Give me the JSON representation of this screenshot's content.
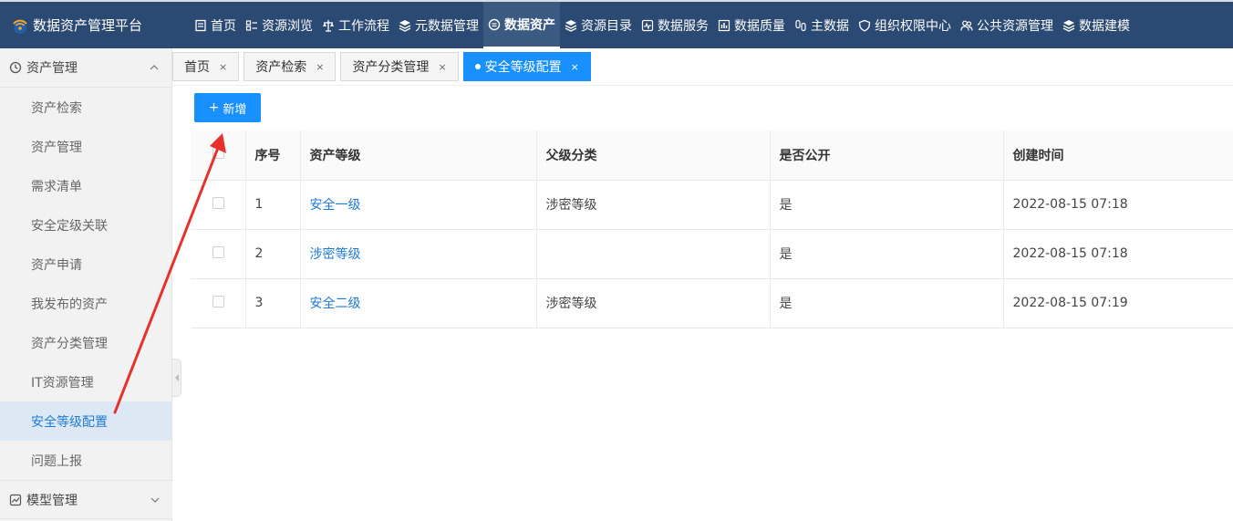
{
  "app": {
    "title": "数据资产管理平台"
  },
  "nav": {
    "items": [
      {
        "label": "首页",
        "icon": "doc-icon"
      },
      {
        "label": "资源浏览",
        "icon": "list-icon"
      },
      {
        "label": "工作流程",
        "icon": "balance-icon"
      },
      {
        "label": "元数据管理",
        "icon": "layers-icon"
      },
      {
        "label": "数据资产",
        "icon": "database-icon",
        "active": true
      },
      {
        "label": "资源目录",
        "icon": "layers-icon"
      },
      {
        "label": "数据服务",
        "icon": "pulse-icon"
      },
      {
        "label": "数据质量",
        "icon": "bar-chart-icon"
      },
      {
        "label": "主数据",
        "icon": "link-icon"
      },
      {
        "label": "组织权限中心",
        "icon": "shield-icon"
      },
      {
        "label": "公共资源管理",
        "icon": "users-icon"
      },
      {
        "label": "数据建模",
        "icon": "layers-icon"
      }
    ]
  },
  "sidebar": {
    "group": {
      "label": "资产管理",
      "icon": "clock-icon"
    },
    "items": [
      {
        "label": "资产检索"
      },
      {
        "label": "资产管理"
      },
      {
        "label": "需求清单"
      },
      {
        "label": "安全定级关联"
      },
      {
        "label": "资产申请"
      },
      {
        "label": "我发布的资产"
      },
      {
        "label": "资产分类管理"
      },
      {
        "label": "IT资源管理"
      },
      {
        "label": "安全等级配置",
        "active": true
      },
      {
        "label": "问题上报"
      }
    ],
    "bottom_group": {
      "label": "模型管理",
      "icon": "chart-icon"
    }
  },
  "tabs": [
    {
      "label": "首页"
    },
    {
      "label": "资产检索"
    },
    {
      "label": "资产分类管理"
    },
    {
      "label": "安全等级配置",
      "active": true
    }
  ],
  "toolbar": {
    "add_label": "新增"
  },
  "table": {
    "headers": [
      "序号",
      "资产等级",
      "父级分类",
      "是否公开",
      "创建时间"
    ],
    "rows": [
      {
        "no": "1",
        "level": "安全一级",
        "parent": "涉密等级",
        "public": "是",
        "time": "2022-08-15 07:18"
      },
      {
        "no": "2",
        "level": "涉密等级",
        "parent": "",
        "public": "是",
        "time": "2022-08-15 07:18"
      },
      {
        "no": "3",
        "level": "安全二级",
        "parent": "涉密等级",
        "public": "是",
        "time": "2022-08-15 07:19"
      }
    ]
  },
  "colors": {
    "topbar": "#2b4a73",
    "accent": "#1890ff",
    "annotation_arrow": "#e8312a"
  }
}
